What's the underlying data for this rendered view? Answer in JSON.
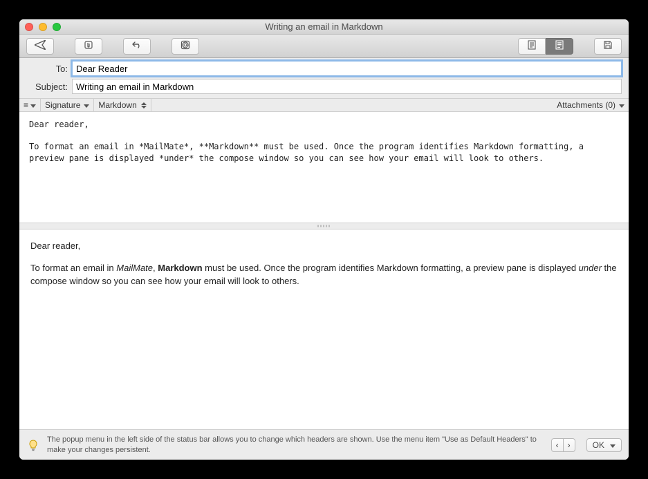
{
  "window": {
    "title": "Writing an email in Markdown"
  },
  "toolbar": {
    "send": {
      "name": "send-button"
    },
    "attach": {
      "name": "attach-button"
    },
    "undo": {
      "name": "undo-button"
    },
    "recipient": {
      "name": "address-button"
    },
    "view_plain": {
      "name": "view-plain-button"
    },
    "view_rich": {
      "name": "view-rich-button"
    },
    "save": {
      "name": "save-draft-button"
    }
  },
  "headers": {
    "to_label": "To:",
    "to_value": "Dear Reader",
    "subject_label": "Subject:",
    "subject_value": "Writing an email in Markdown"
  },
  "format_row": {
    "signature_label": "Signature",
    "format_label": "Markdown",
    "attachments_label": "Attachments (0)"
  },
  "compose_text": "Dear reader,\n\nTo format an email in *MailMate*, **Markdown** must be used. Once the program identifies Markdown formatting, a preview pane is displayed *under* the compose window so you can see how your email will look to others.",
  "preview": {
    "greeting": "Dear reader,",
    "body_parts": {
      "p1": "To format an email in ",
      "i1": "MailMate",
      "p2": ", ",
      "b1": "Markdown",
      "p3": " must be used. Once the program identifies Markdown formatting, a preview pane is displayed ",
      "i2": "under",
      "p4": " the compose window so you can see how your email will look to others."
    }
  },
  "tip": {
    "text": "The popup menu in the left side of the status bar allows you to change which headers are shown. Use the menu item \"Use as Default Headers\" to make your changes persistent.",
    "ok_label": "OK"
  }
}
